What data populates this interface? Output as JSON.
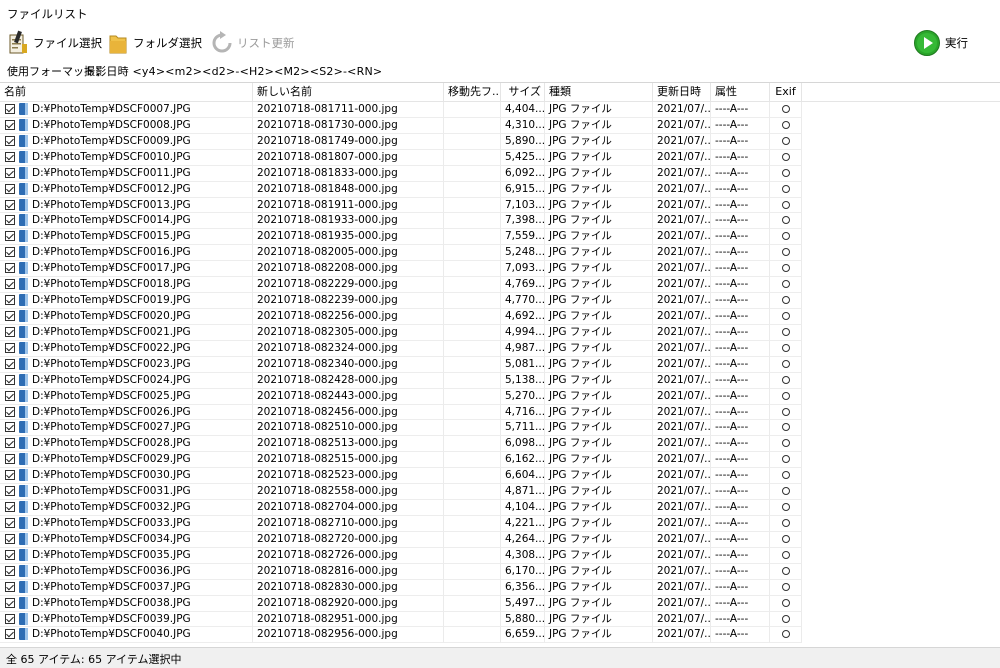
{
  "window": {
    "title": "ファイルリスト"
  },
  "toolbar": {
    "file_select": "ファイル選択",
    "folder_select": "フォルダ選択",
    "refresh": "リスト更新",
    "execute": "実行"
  },
  "format": {
    "label": "使用フォーマット：",
    "value": "撮影日時 <y4><m2><d2>-<H2><M2><S2>-<RN>"
  },
  "columns": [
    "名前",
    "新しい名前",
    "移動先フ...",
    "サイズ",
    "種類",
    "更新日時",
    "属性",
    "Exif"
  ],
  "rows": [
    {
      "name": "D:¥PhotoTemp¥DSCF0007.JPG",
      "newname": "20210718-081711-000.jpg",
      "dest": "",
      "size": "4,404...",
      "type": "JPG ファイル",
      "date": "2021/07/...",
      "attr": "----A---",
      "exif": true
    },
    {
      "name": "D:¥PhotoTemp¥DSCF0008.JPG",
      "newname": "20210718-081730-000.jpg",
      "dest": "",
      "size": "4,310...",
      "type": "JPG ファイル",
      "date": "2021/07/...",
      "attr": "----A---",
      "exif": true
    },
    {
      "name": "D:¥PhotoTemp¥DSCF0009.JPG",
      "newname": "20210718-081749-000.jpg",
      "dest": "",
      "size": "5,890...",
      "type": "JPG ファイル",
      "date": "2021/07/...",
      "attr": "----A---",
      "exif": true
    },
    {
      "name": "D:¥PhotoTemp¥DSCF0010.JPG",
      "newname": "20210718-081807-000.jpg",
      "dest": "",
      "size": "5,425...",
      "type": "JPG ファイル",
      "date": "2021/07/...",
      "attr": "----A---",
      "exif": true
    },
    {
      "name": "D:¥PhotoTemp¥DSCF0011.JPG",
      "newname": "20210718-081833-000.jpg",
      "dest": "",
      "size": "6,092...",
      "type": "JPG ファイル",
      "date": "2021/07/...",
      "attr": "----A---",
      "exif": true
    },
    {
      "name": "D:¥PhotoTemp¥DSCF0012.JPG",
      "newname": "20210718-081848-000.jpg",
      "dest": "",
      "size": "6,915...",
      "type": "JPG ファイル",
      "date": "2021/07/...",
      "attr": "----A---",
      "exif": true
    },
    {
      "name": "D:¥PhotoTemp¥DSCF0013.JPG",
      "newname": "20210718-081911-000.jpg",
      "dest": "",
      "size": "7,103...",
      "type": "JPG ファイル",
      "date": "2021/07/...",
      "attr": "----A---",
      "exif": true
    },
    {
      "name": "D:¥PhotoTemp¥DSCF0014.JPG",
      "newname": "20210718-081933-000.jpg",
      "dest": "",
      "size": "7,398...",
      "type": "JPG ファイル",
      "date": "2021/07/...",
      "attr": "----A---",
      "exif": true
    },
    {
      "name": "D:¥PhotoTemp¥DSCF0015.JPG",
      "newname": "20210718-081935-000.jpg",
      "dest": "",
      "size": "7,559...",
      "type": "JPG ファイル",
      "date": "2021/07/...",
      "attr": "----A---",
      "exif": true
    },
    {
      "name": "D:¥PhotoTemp¥DSCF0016.JPG",
      "newname": "20210718-082005-000.jpg",
      "dest": "",
      "size": "5,248...",
      "type": "JPG ファイル",
      "date": "2021/07/...",
      "attr": "----A---",
      "exif": true
    },
    {
      "name": "D:¥PhotoTemp¥DSCF0017.JPG",
      "newname": "20210718-082208-000.jpg",
      "dest": "",
      "size": "7,093...",
      "type": "JPG ファイル",
      "date": "2021/07/...",
      "attr": "----A---",
      "exif": true
    },
    {
      "name": "D:¥PhotoTemp¥DSCF0018.JPG",
      "newname": "20210718-082229-000.jpg",
      "dest": "",
      "size": "4,769...",
      "type": "JPG ファイル",
      "date": "2021/07/...",
      "attr": "----A---",
      "exif": true
    },
    {
      "name": "D:¥PhotoTemp¥DSCF0019.JPG",
      "newname": "20210718-082239-000.jpg",
      "dest": "",
      "size": "4,770...",
      "type": "JPG ファイル",
      "date": "2021/07/...",
      "attr": "----A---",
      "exif": true
    },
    {
      "name": "D:¥PhotoTemp¥DSCF0020.JPG",
      "newname": "20210718-082256-000.jpg",
      "dest": "",
      "size": "4,692...",
      "type": "JPG ファイル",
      "date": "2021/07/...",
      "attr": "----A---",
      "exif": true
    },
    {
      "name": "D:¥PhotoTemp¥DSCF0021.JPG",
      "newname": "20210718-082305-000.jpg",
      "dest": "",
      "size": "4,994...",
      "type": "JPG ファイル",
      "date": "2021/07/...",
      "attr": "----A---",
      "exif": true
    },
    {
      "name": "D:¥PhotoTemp¥DSCF0022.JPG",
      "newname": "20210718-082324-000.jpg",
      "dest": "",
      "size": "4,987...",
      "type": "JPG ファイル",
      "date": "2021/07/...",
      "attr": "----A---",
      "exif": true
    },
    {
      "name": "D:¥PhotoTemp¥DSCF0023.JPG",
      "newname": "20210718-082340-000.jpg",
      "dest": "",
      "size": "5,081...",
      "type": "JPG ファイル",
      "date": "2021/07/...",
      "attr": "----A---",
      "exif": true
    },
    {
      "name": "D:¥PhotoTemp¥DSCF0024.JPG",
      "newname": "20210718-082428-000.jpg",
      "dest": "",
      "size": "5,138...",
      "type": "JPG ファイル",
      "date": "2021/07/...",
      "attr": "----A---",
      "exif": true
    },
    {
      "name": "D:¥PhotoTemp¥DSCF0025.JPG",
      "newname": "20210718-082443-000.jpg",
      "dest": "",
      "size": "5,270...",
      "type": "JPG ファイル",
      "date": "2021/07/...",
      "attr": "----A---",
      "exif": true
    },
    {
      "name": "D:¥PhotoTemp¥DSCF0026.JPG",
      "newname": "20210718-082456-000.jpg",
      "dest": "",
      "size": "4,716...",
      "type": "JPG ファイル",
      "date": "2021/07/...",
      "attr": "----A---",
      "exif": true
    },
    {
      "name": "D:¥PhotoTemp¥DSCF0027.JPG",
      "newname": "20210718-082510-000.jpg",
      "dest": "",
      "size": "5,711...",
      "type": "JPG ファイル",
      "date": "2021/07/...",
      "attr": "----A---",
      "exif": true
    },
    {
      "name": "D:¥PhotoTemp¥DSCF0028.JPG",
      "newname": "20210718-082513-000.jpg",
      "dest": "",
      "size": "6,098...",
      "type": "JPG ファイル",
      "date": "2021/07/...",
      "attr": "----A---",
      "exif": true
    },
    {
      "name": "D:¥PhotoTemp¥DSCF0029.JPG",
      "newname": "20210718-082515-000.jpg",
      "dest": "",
      "size": "6,162...",
      "type": "JPG ファイル",
      "date": "2021/07/...",
      "attr": "----A---",
      "exif": true
    },
    {
      "name": "D:¥PhotoTemp¥DSCF0030.JPG",
      "newname": "20210718-082523-000.jpg",
      "dest": "",
      "size": "6,604...",
      "type": "JPG ファイル",
      "date": "2021/07/...",
      "attr": "----A---",
      "exif": true
    },
    {
      "name": "D:¥PhotoTemp¥DSCF0031.JPG",
      "newname": "20210718-082558-000.jpg",
      "dest": "",
      "size": "4,871...",
      "type": "JPG ファイル",
      "date": "2021/07/...",
      "attr": "----A---",
      "exif": true
    },
    {
      "name": "D:¥PhotoTemp¥DSCF0032.JPG",
      "newname": "20210718-082704-000.jpg",
      "dest": "",
      "size": "4,104...",
      "type": "JPG ファイル",
      "date": "2021/07/...",
      "attr": "----A---",
      "exif": true
    },
    {
      "name": "D:¥PhotoTemp¥DSCF0033.JPG",
      "newname": "20210718-082710-000.jpg",
      "dest": "",
      "size": "4,221...",
      "type": "JPG ファイル",
      "date": "2021/07/...",
      "attr": "----A---",
      "exif": true
    },
    {
      "name": "D:¥PhotoTemp¥DSCF0034.JPG",
      "newname": "20210718-082720-000.jpg",
      "dest": "",
      "size": "4,264...",
      "type": "JPG ファイル",
      "date": "2021/07/...",
      "attr": "----A---",
      "exif": true
    },
    {
      "name": "D:¥PhotoTemp¥DSCF0035.JPG",
      "newname": "20210718-082726-000.jpg",
      "dest": "",
      "size": "4,308...",
      "type": "JPG ファイル",
      "date": "2021/07/...",
      "attr": "----A---",
      "exif": true
    },
    {
      "name": "D:¥PhotoTemp¥DSCF0036.JPG",
      "newname": "20210718-082816-000.jpg",
      "dest": "",
      "size": "6,170...",
      "type": "JPG ファイル",
      "date": "2021/07/...",
      "attr": "----A---",
      "exif": true
    },
    {
      "name": "D:¥PhotoTemp¥DSCF0037.JPG",
      "newname": "20210718-082830-000.jpg",
      "dest": "",
      "size": "6,356...",
      "type": "JPG ファイル",
      "date": "2021/07/...",
      "attr": "----A---",
      "exif": true
    },
    {
      "name": "D:¥PhotoTemp¥DSCF0038.JPG",
      "newname": "20210718-082920-000.jpg",
      "dest": "",
      "size": "5,497...",
      "type": "JPG ファイル",
      "date": "2021/07/...",
      "attr": "----A---",
      "exif": true
    },
    {
      "name": "D:¥PhotoTemp¥DSCF0039.JPG",
      "newname": "20210718-082951-000.jpg",
      "dest": "",
      "size": "5,880...",
      "type": "JPG ファイル",
      "date": "2021/07/...",
      "attr": "----A---",
      "exif": true
    },
    {
      "name": "D:¥PhotoTemp¥DSCF0040.JPG",
      "newname": "20210718-082956-000.jpg",
      "dest": "",
      "size": "6,659...",
      "type": "JPG ファイル",
      "date": "2021/07/...",
      "attr": "----A---",
      "exif": true
    }
  ],
  "status": {
    "text": "全 65 アイテム: 65 アイテム選択中"
  },
  "icons": {
    "file_select": "document-wand-icon",
    "folder_select": "folder-icon",
    "refresh": "refresh-icon",
    "execute": "play-icon",
    "file": "file-icon",
    "exif": "circle-icon"
  },
  "colors": {
    "execute_green": "#2aa52a",
    "folder_yellow": "#e9b43a",
    "file_blue": "#2e6db4"
  }
}
